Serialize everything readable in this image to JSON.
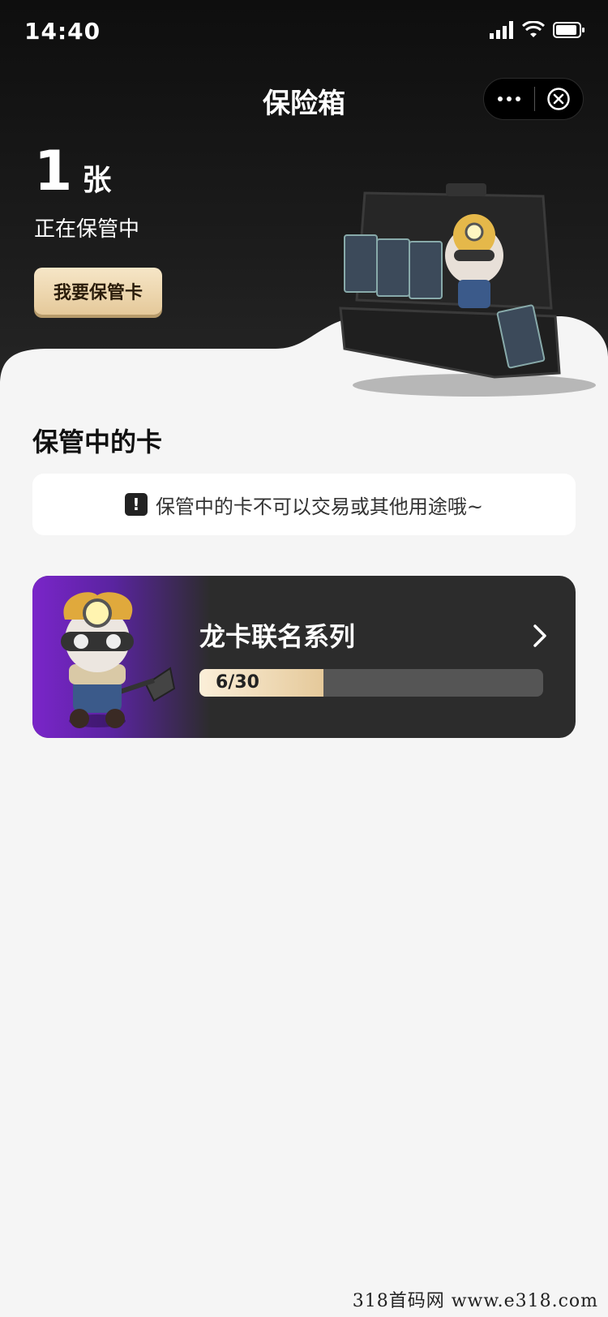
{
  "status_bar": {
    "time": "14:40"
  },
  "nav": {
    "title": "保险箱"
  },
  "summary": {
    "count": "1",
    "unit": "张",
    "subtitle": "正在保管中",
    "keep_button": "我要保管卡"
  },
  "section": {
    "title": "保管中的卡"
  },
  "notice": {
    "text": "保管中的卡不可以交易或其他用途哦~"
  },
  "series": {
    "name": "龙卡联名系列",
    "progress_text": "6/30",
    "collected": 6,
    "total": 30
  },
  "watermark": "318首码网 www.e318.com",
  "colors": {
    "accent_gold": "#e5c99a",
    "accent_purple": "#7a25c9",
    "card_bg": "#2c2c2c"
  }
}
